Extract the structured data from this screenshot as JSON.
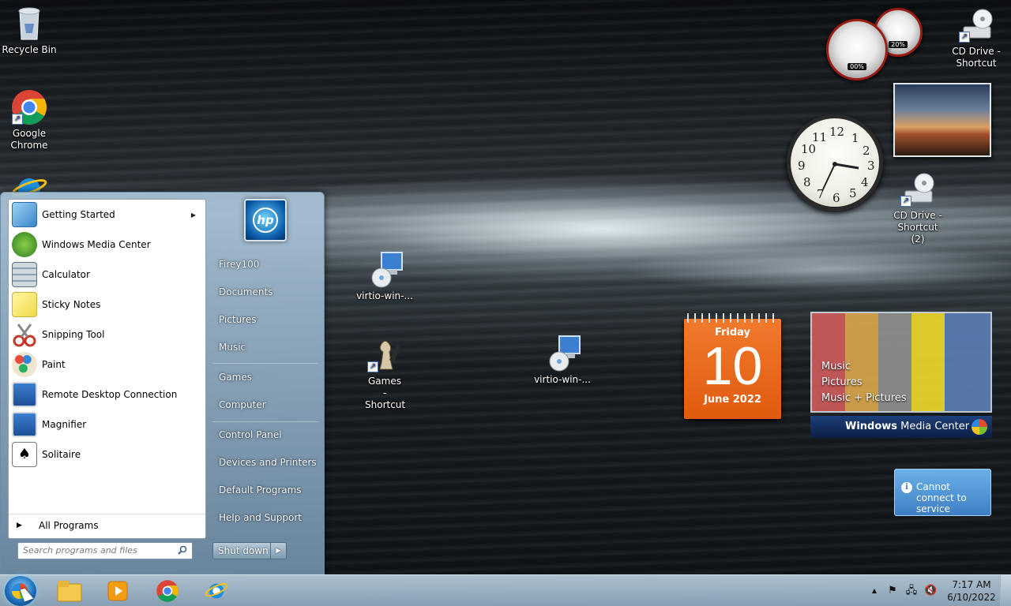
{
  "desktop": {
    "icons": {
      "recycle_bin": "Recycle Bin",
      "chrome": "Google Chrome",
      "cd_drive": "CD Drive - Shortcut",
      "cd_drive_2": "CD Drive - Shortcut (2)",
      "virtio_1": "virtio-win-...",
      "games": "Games - Shortcut",
      "virtio_2": "virtio-win-..."
    }
  },
  "gadgets": {
    "cpu_meter": {
      "cpu_label": "00%",
      "memory_label": "20%"
    },
    "clock": {
      "numbers": [
        "12",
        "1",
        "2",
        "3",
        "4",
        "5",
        "6",
        "7",
        "8",
        "9",
        "10",
        "11"
      ]
    },
    "calendar": {
      "weekday": "Friday",
      "day": "10",
      "month_year": "June 2022"
    },
    "media_center": {
      "menu": [
        "Music",
        "Pictures",
        "Music + Pictures"
      ],
      "brand_prefix": "Windows",
      "brand_suffix": " Media Center"
    },
    "notice": {
      "icon": "i",
      "text": "Cannot connect to service"
    }
  },
  "start_menu": {
    "programs": [
      {
        "label": "Getting Started",
        "icon": "getting-started-icon",
        "has_submenu": true
      },
      {
        "label": "Windows Media Center",
        "icon": "media-center-icon"
      },
      {
        "label": "Calculator",
        "icon": "calculator-icon"
      },
      {
        "label": "Sticky Notes",
        "icon": "sticky-notes-icon"
      },
      {
        "label": "Snipping Tool",
        "icon": "snipping-tool-icon"
      },
      {
        "label": "Paint",
        "icon": "paint-icon"
      },
      {
        "label": "Remote Desktop Connection",
        "icon": "remote-desktop-icon"
      },
      {
        "label": "Magnifier",
        "icon": "magnifier-icon"
      },
      {
        "label": "Solitaire",
        "icon": "solitaire-icon"
      }
    ],
    "all_programs": "All Programs",
    "search_placeholder": "Search programs and files",
    "user_logo": "hp",
    "right_items": [
      {
        "label": "Firey100"
      },
      {
        "label": "Documents"
      },
      {
        "label": "Pictures"
      },
      {
        "label": "Music"
      },
      {
        "label": "Games"
      },
      {
        "label": "Computer"
      },
      {
        "label": "Control Panel"
      },
      {
        "label": "Devices and Printers"
      },
      {
        "label": "Default Programs"
      },
      {
        "label": "Help and Support"
      }
    ],
    "shutdown_label": "Shut down"
  },
  "taskbar": {
    "pinned": [
      "file-explorer-icon",
      "media-player-icon",
      "chrome-icon",
      "internet-explorer-icon"
    ],
    "time": "7:17 AM",
    "date": "6/10/2022"
  },
  "colors": {
    "calendar": "#e15a0e",
    "notice": "#3e7fc4",
    "taskbar": "#a8c0d2"
  }
}
